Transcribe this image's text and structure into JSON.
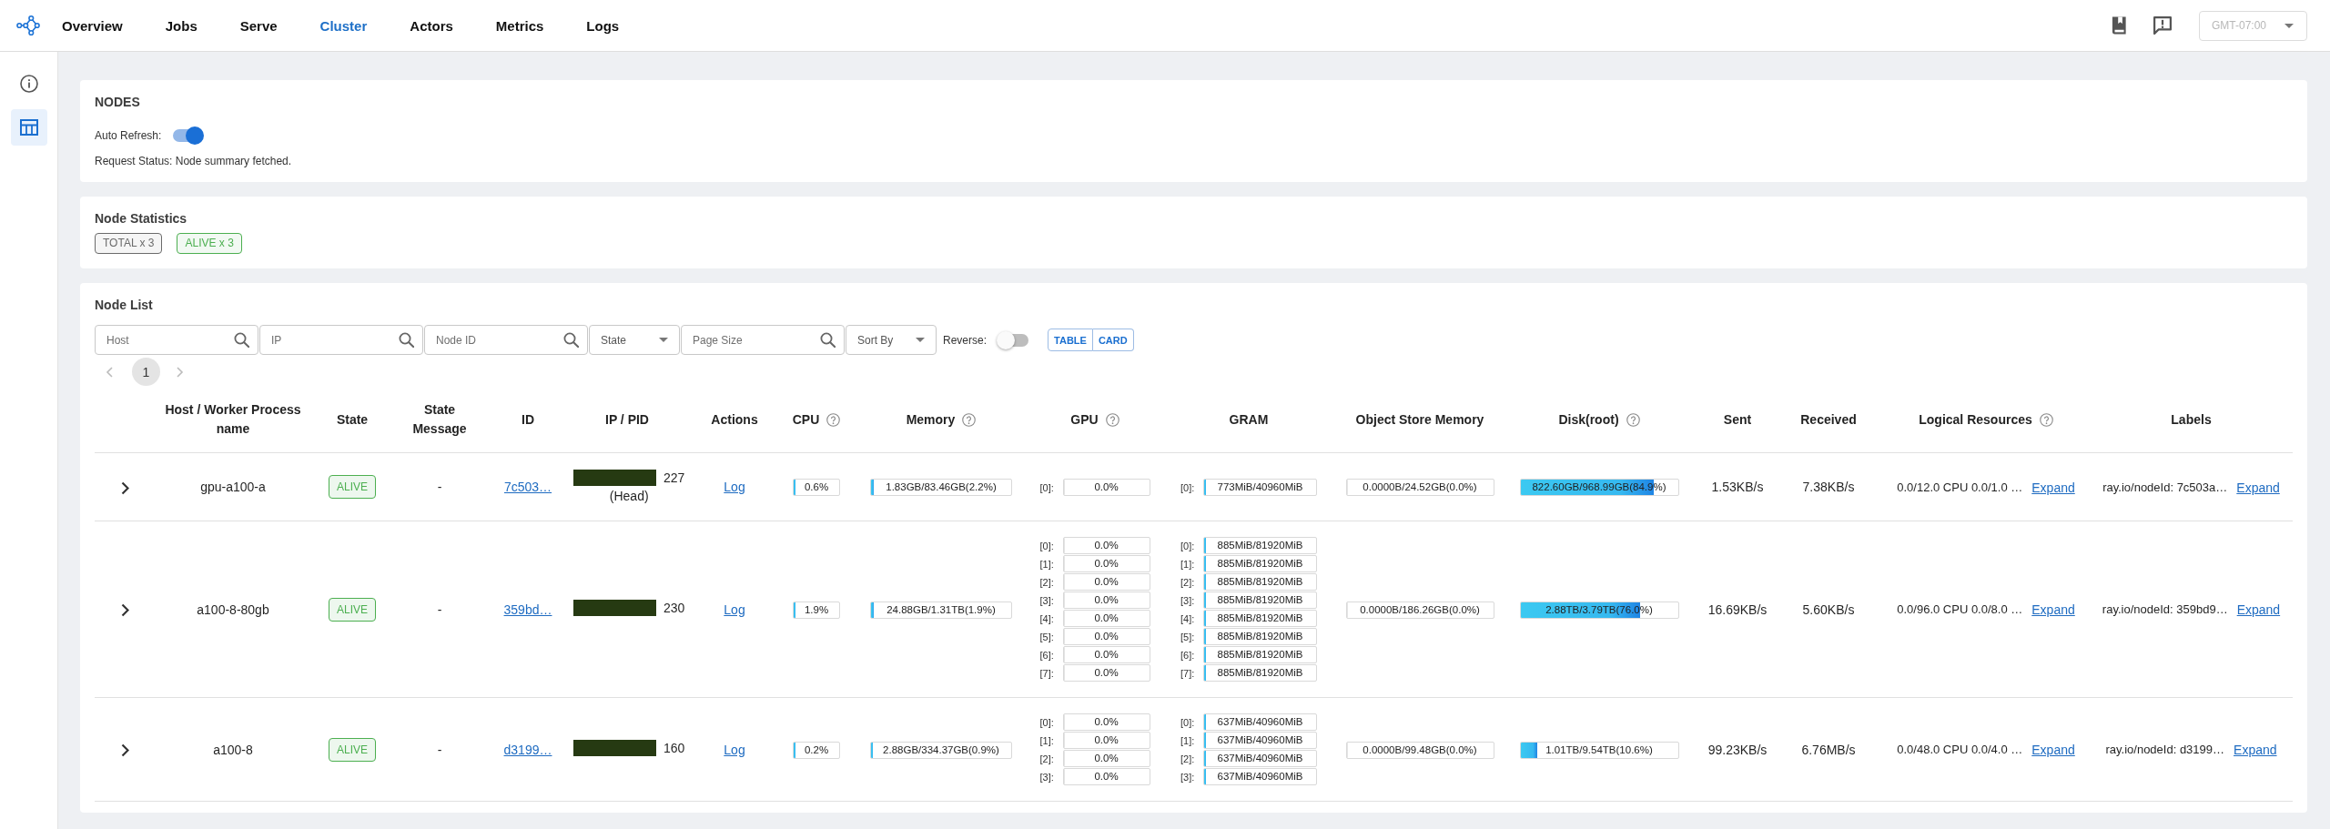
{
  "nav": {
    "tabs": [
      {
        "label": "Overview",
        "selected": false
      },
      {
        "label": "Jobs",
        "selected": false
      },
      {
        "label": "Serve",
        "selected": false
      },
      {
        "label": "Cluster",
        "selected": true
      },
      {
        "label": "Actors",
        "selected": false
      },
      {
        "label": "Metrics",
        "selected": false
      },
      {
        "label": "Logs",
        "selected": false
      }
    ],
    "timezone": "GMT-07:00"
  },
  "sidebar": {
    "items": [
      {
        "kind": "info",
        "selected": false
      },
      {
        "kind": "table",
        "selected": true
      }
    ]
  },
  "nodes_card": {
    "title": "NODES",
    "auto_refresh": {
      "label": "Auto Refresh:",
      "on": true
    },
    "request_status": "Request Status: Node summary fetched."
  },
  "node_statistics": {
    "title": "Node Statistics",
    "chips": [
      {
        "label": "TOTAL x 3",
        "color": "#6b6b6b"
      },
      {
        "label": "ALIVE x 3",
        "color": "#4caf50"
      }
    ]
  },
  "node_list": {
    "title": "Node List",
    "filters": [
      {
        "kind": "search",
        "placeholder": "Host"
      },
      {
        "kind": "search",
        "placeholder": "IP"
      },
      {
        "kind": "search",
        "placeholder": "Node ID"
      },
      {
        "kind": "select",
        "label": "State"
      },
      {
        "kind": "search",
        "placeholder": "Page Size"
      },
      {
        "kind": "select",
        "label": "Sort By"
      }
    ],
    "reverse": {
      "label": "Reverse:",
      "on": false
    },
    "views": [
      {
        "label": "TABLE",
        "selected": false
      },
      {
        "label": "CARD",
        "selected": false
      }
    ],
    "pages": [
      {
        "label": "1",
        "selected": true
      }
    ],
    "table": {
      "columns": [
        {
          "label": "Host / Worker Process name",
          "help": false
        },
        {
          "label": "State",
          "help": false
        },
        {
          "label": "State Message",
          "help": false
        },
        {
          "label": "ID",
          "help": false
        },
        {
          "label": "IP / PID",
          "help": false
        },
        {
          "label": "Actions",
          "help": false
        },
        {
          "label": "CPU",
          "help": true
        },
        {
          "label": "Memory",
          "help": true
        },
        {
          "label": "GPU",
          "help": true
        },
        {
          "label": "GRAM",
          "help": false
        },
        {
          "label": "Object Store Memory",
          "help": false
        },
        {
          "label": "Disk(root)",
          "help": true
        },
        {
          "label": "Sent",
          "help": false
        },
        {
          "label": "Received",
          "help": false
        },
        {
          "label": "Logical Resources",
          "help": true
        },
        {
          "label": "Labels",
          "help": false
        }
      ],
      "rows": [
        {
          "expanded": false,
          "host": "gpu-a100-a",
          "state": {
            "label": "ALIVE",
            "color": "#4caf50"
          },
          "state_message": "-",
          "id": "7c503…",
          "pid": "227",
          "role": "(Head)",
          "action": "Log",
          "cpu": {
            "text": "0.6%",
            "level": 0.006
          },
          "memory": {
            "text": "1.83GB/83.46GB(2.2%)",
            "level": 0.022
          },
          "gpu": [
            {
              "index": "[0]:",
              "text": "0.0%",
              "level": 0
            }
          ],
          "gram": [
            {
              "index": "[0]:",
              "text": "773MiB/40960MiB",
              "level": 0.019
            }
          ],
          "object_store": {
            "text": "0.0000B/24.52GB(0.0%)",
            "level": 0
          },
          "disk": {
            "text": "822.60GB/968.99GB(84.9%)",
            "level": 0.849
          },
          "sent": "1.53KB/s",
          "received": "7.38KB/s",
          "logical_resources": {
            "text": "0.0/12.0 CPU 0.0/1.0 …",
            "link": "Expand"
          },
          "labels": {
            "text": "ray.io/nodeId: 7c503a…",
            "link": "Expand"
          }
        },
        {
          "expanded": false,
          "host": "a100-8-80gb",
          "state": {
            "label": "ALIVE",
            "color": "#4caf50"
          },
          "state_message": "-",
          "id": "359bd…",
          "pid": "230",
          "action": "Log",
          "cpu": {
            "text": "1.9%",
            "level": 0.019
          },
          "memory": {
            "text": "24.88GB/1.31TB(1.9%)",
            "level": 0.019
          },
          "gpu": [
            {
              "index": "[0]:",
              "text": "0.0%",
              "level": 0
            },
            {
              "index": "[1]:",
              "text": "0.0%",
              "level": 0
            },
            {
              "index": "[2]:",
              "text": "0.0%",
              "level": 0
            },
            {
              "index": "[3]:",
              "text": "0.0%",
              "level": 0
            },
            {
              "index": "[4]:",
              "text": "0.0%",
              "level": 0
            },
            {
              "index": "[5]:",
              "text": "0.0%",
              "level": 0
            },
            {
              "index": "[6]:",
              "text": "0.0%",
              "level": 0
            },
            {
              "index": "[7]:",
              "text": "0.0%",
              "level": 0
            }
          ],
          "gram": [
            {
              "index": "[0]:",
              "text": "885MiB/81920MiB",
              "level": 0.011
            },
            {
              "index": "[1]:",
              "text": "885MiB/81920MiB",
              "level": 0.011
            },
            {
              "index": "[2]:",
              "text": "885MiB/81920MiB",
              "level": 0.011
            },
            {
              "index": "[3]:",
              "text": "885MiB/81920MiB",
              "level": 0.011
            },
            {
              "index": "[4]:",
              "text": "885MiB/81920MiB",
              "level": 0.011
            },
            {
              "index": "[5]:",
              "text": "885MiB/81920MiB",
              "level": 0.011
            },
            {
              "index": "[6]:",
              "text": "885MiB/81920MiB",
              "level": 0.011
            },
            {
              "index": "[7]:",
              "text": "885MiB/81920MiB",
              "level": 0.011
            }
          ],
          "object_store": {
            "text": "0.0000B/186.26GB(0.0%)",
            "level": 0
          },
          "disk": {
            "text": "2.88TB/3.79TB(76.0%)",
            "level": 0.76
          },
          "sent": "16.69KB/s",
          "received": "5.60KB/s",
          "logical_resources": {
            "text": "0.0/96.0 CPU 0.0/8.0 …",
            "link": "Expand"
          },
          "labels": {
            "text": "ray.io/nodeId: 359bd9…",
            "link": "Expand"
          }
        },
        {
          "expanded": false,
          "host": "a100-8",
          "state": {
            "label": "ALIVE",
            "color": "#4caf50"
          },
          "state_message": "-",
          "id": "d3199…",
          "pid": "160",
          "action": "Log",
          "cpu": {
            "text": "0.2%",
            "level": 0.002
          },
          "memory": {
            "text": "2.88GB/334.37GB(0.9%)",
            "level": 0.009
          },
          "gpu": [
            {
              "index": "[0]:",
              "text": "0.0%",
              "level": 0
            },
            {
              "index": "[1]:",
              "text": "0.0%",
              "level": 0
            },
            {
              "index": "[2]:",
              "text": "0.0%",
              "level": 0
            },
            {
              "index": "[3]:",
              "text": "0.0%",
              "level": 0
            }
          ],
          "gram": [
            {
              "index": "[0]:",
              "text": "637MiB/40960MiB",
              "level": 0.016
            },
            {
              "index": "[1]:",
              "text": "637MiB/40960MiB",
              "level": 0.016
            },
            {
              "index": "[2]:",
              "text": "637MiB/40960MiB",
              "level": 0.016
            },
            {
              "index": "[3]:",
              "text": "637MiB/40960MiB",
              "level": 0.016
            }
          ],
          "object_store": {
            "text": "0.0000B/99.48GB(0.0%)",
            "level": 0
          },
          "disk": {
            "text": "1.01TB/9.54TB(10.6%)",
            "level": 0.106
          },
          "sent": "99.23KB/s",
          "received": "6.76MB/s",
          "logical_resources": {
            "text": "0.0/48.0 CPU 0.0/4.0 …",
            "link": "Expand"
          },
          "labels": {
            "text": "ray.io/nodeId: d3199…",
            "link": "Expand"
          }
        }
      ]
    }
  }
}
